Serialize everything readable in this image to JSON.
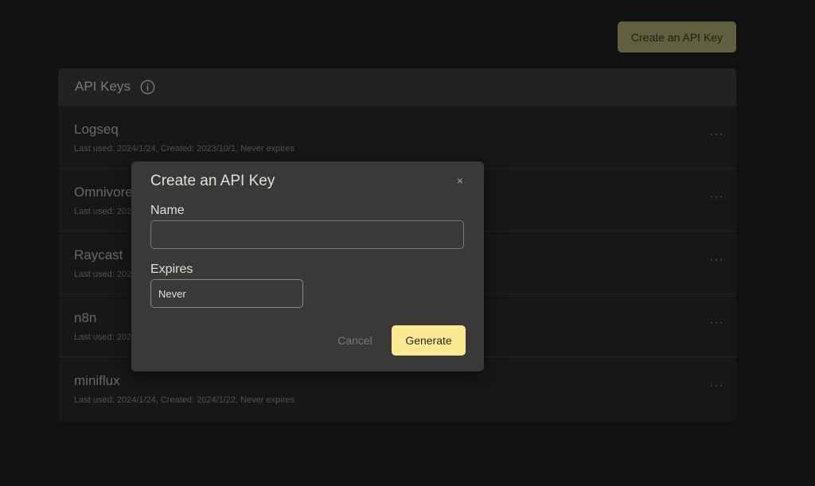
{
  "header": {
    "create_button_label": "Create an API Key"
  },
  "panel": {
    "title": "API Keys",
    "info_icon": "info-icon",
    "keys": [
      {
        "name": "Logseq",
        "meta": "Last used: 2024/1/24, Created: 2023/10/1, Never expires"
      },
      {
        "name": "Omnivore",
        "meta": "Last used: 2024/1/24"
      },
      {
        "name": "Raycast",
        "meta": "Last used: 2024/1/24"
      },
      {
        "name": "n8n",
        "meta": "Last used: 2024/1/24"
      },
      {
        "name": "miniflux",
        "meta": "Last used: 2024/1/24, Created: 2024/1/22, Never expires"
      }
    ],
    "more_glyph": "···"
  },
  "modal": {
    "title": "Create an API Key",
    "close_glyph": "×",
    "name_label": "Name",
    "name_value": "",
    "expires_label": "Expires",
    "expires_value": "Never",
    "cancel_label": "Cancel",
    "generate_label": "Generate"
  },
  "colors": {
    "background": "#121111",
    "accent": "#fde992",
    "accent_dim": "#625e40"
  }
}
